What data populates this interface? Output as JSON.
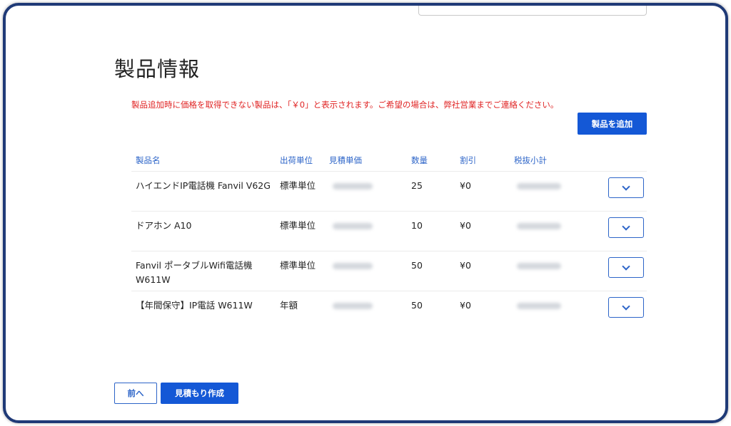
{
  "page": {
    "title": "製品情報",
    "notice": "製品追加時に価格を取得できない製品は、「￥0」と表示されます。ご希望の場合は、弊社営業までご連絡ください。",
    "add_button": "製品を追加"
  },
  "table": {
    "headers": {
      "name": "製品名",
      "unit": "出荷単位",
      "price": "見積単価",
      "qty": "数量",
      "discount": "割引",
      "subtotal": "税抜小計"
    },
    "rows": [
      {
        "name": "ハイエンドIP電話機 Fanvil V62G",
        "unit": "標準単位",
        "qty": "25",
        "discount": "¥0"
      },
      {
        "name": "ドアホン A10",
        "unit": "標準単位",
        "qty": "10",
        "discount": "¥0"
      },
      {
        "name": "Fanvil ポータブルWifi電話機 W611W",
        "unit": "標準単位",
        "qty": "50",
        "discount": "¥0"
      },
      {
        "name": "【年間保守】IP電話 W611W",
        "unit": "年額",
        "qty": "50",
        "discount": "¥0"
      }
    ]
  },
  "footer": {
    "back_button": "前へ",
    "quote_button": "見積もり作成"
  },
  "icons": {
    "expand": "chevron-down-icon"
  },
  "colors": {
    "primary": "#1458d6",
    "notice": "#e02424",
    "header_text": "#2c64c8",
    "frame": "#1f3a77"
  }
}
